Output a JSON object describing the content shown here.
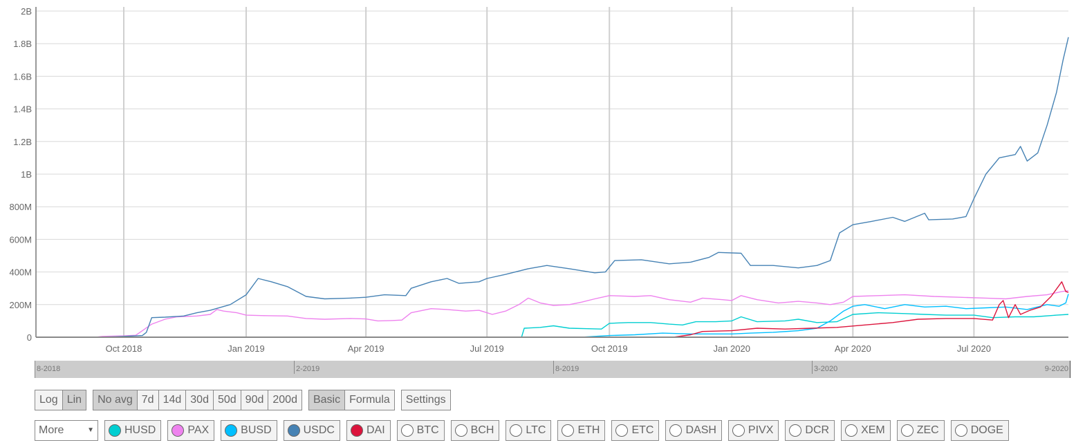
{
  "chart_data": {
    "type": "line",
    "title": "",
    "xlabel": "",
    "ylabel": "",
    "ylim": [
      0,
      2000000000
    ],
    "xlim": [
      "2018-07-27",
      "2020-09-10"
    ],
    "grid": true,
    "y_ticks": [
      {
        "value": 0,
        "label": "0"
      },
      {
        "value": 200000000,
        "label": "200M"
      },
      {
        "value": 400000000,
        "label": "400M"
      },
      {
        "value": 600000000,
        "label": "600M"
      },
      {
        "value": 800000000,
        "label": "800M"
      },
      {
        "value": 1000000000,
        "label": "1B"
      },
      {
        "value": 1200000000,
        "label": "1.2B"
      },
      {
        "value": 1400000000,
        "label": "1.4B"
      },
      {
        "value": 1600000000,
        "label": "1.6B"
      },
      {
        "value": 1800000000,
        "label": "1.8B"
      },
      {
        "value": 2000000000,
        "label": "2B"
      }
    ],
    "x_ticks": [
      {
        "date": "2018-10-01",
        "label": "Oct 2018"
      },
      {
        "date": "2019-01-01",
        "label": "Jan 2019"
      },
      {
        "date": "2019-04-01",
        "label": "Apr 2019"
      },
      {
        "date": "2019-07-01",
        "label": "Jul 2019"
      },
      {
        "date": "2019-10-01",
        "label": "Oct 2019"
      },
      {
        "date": "2020-01-01",
        "label": "Jan 2020"
      },
      {
        "date": "2020-04-01",
        "label": "Apr 2020"
      },
      {
        "date": "2020-07-01",
        "label": "Jul 2020"
      }
    ],
    "value_unit": "millions",
    "series": [
      {
        "name": "PAX",
        "color": "#EE82EE",
        "points": [
          [
            "2018-07-27",
            0
          ],
          [
            "2018-09-10",
            0
          ],
          [
            "2018-09-15",
            5
          ],
          [
            "2018-10-01",
            8
          ],
          [
            "2018-10-10",
            12
          ],
          [
            "2018-10-15",
            40
          ],
          [
            "2018-10-22",
            80
          ],
          [
            "2018-11-01",
            110
          ],
          [
            "2018-11-10",
            125
          ],
          [
            "2018-11-25",
            130
          ],
          [
            "2018-12-05",
            140
          ],
          [
            "2018-12-10",
            170
          ],
          [
            "2018-12-15",
            160
          ],
          [
            "2018-12-25",
            150
          ],
          [
            "2019-01-01",
            135
          ],
          [
            "2019-01-15",
            132
          ],
          [
            "2019-02-01",
            130
          ],
          [
            "2019-02-15",
            115
          ],
          [
            "2019-03-01",
            110
          ],
          [
            "2019-03-20",
            115
          ],
          [
            "2019-04-01",
            112
          ],
          [
            "2019-04-10",
            100
          ],
          [
            "2019-04-20",
            102
          ],
          [
            "2019-04-28",
            105
          ],
          [
            "2019-05-05",
            150
          ],
          [
            "2019-05-20",
            175
          ],
          [
            "2019-06-01",
            170
          ],
          [
            "2019-06-15",
            160
          ],
          [
            "2019-06-25",
            165
          ],
          [
            "2019-07-01",
            150
          ],
          [
            "2019-07-05",
            140
          ],
          [
            "2019-07-15",
            160
          ],
          [
            "2019-07-25",
            200
          ],
          [
            "2019-08-01",
            240
          ],
          [
            "2019-08-10",
            210
          ],
          [
            "2019-08-20",
            195
          ],
          [
            "2019-09-01",
            200
          ],
          [
            "2019-09-10",
            215
          ],
          [
            "2019-09-20",
            235
          ],
          [
            "2019-10-01",
            255
          ],
          [
            "2019-10-20",
            250
          ],
          [
            "2019-11-01",
            255
          ],
          [
            "2019-11-15",
            230
          ],
          [
            "2019-12-01",
            215
          ],
          [
            "2019-12-10",
            240
          ],
          [
            "2019-12-25",
            230
          ],
          [
            "2020-01-01",
            225
          ],
          [
            "2020-01-08",
            255
          ],
          [
            "2020-01-20",
            230
          ],
          [
            "2020-02-05",
            210
          ],
          [
            "2020-02-20",
            220
          ],
          [
            "2020-03-05",
            210
          ],
          [
            "2020-03-15",
            200
          ],
          [
            "2020-03-25",
            215
          ],
          [
            "2020-04-01",
            250
          ],
          [
            "2020-04-20",
            255
          ],
          [
            "2020-05-10",
            260
          ],
          [
            "2020-06-01",
            250
          ],
          [
            "2020-06-20",
            245
          ],
          [
            "2020-07-10",
            240
          ],
          [
            "2020-07-25",
            235
          ],
          [
            "2020-08-10",
            250
          ],
          [
            "2020-08-25",
            260
          ],
          [
            "2020-09-05",
            280
          ],
          [
            "2020-09-10",
            285
          ]
        ]
      },
      {
        "name": "HUSD",
        "color": "#00CED1",
        "points": [
          [
            "2019-07-27",
            0
          ],
          [
            "2019-07-29",
            55
          ],
          [
            "2019-08-10",
            60
          ],
          [
            "2019-08-20",
            70
          ],
          [
            "2019-09-01",
            55
          ],
          [
            "2019-09-15",
            52
          ],
          [
            "2019-09-25",
            50
          ],
          [
            "2019-10-01",
            85
          ],
          [
            "2019-10-15",
            90
          ],
          [
            "2019-11-01",
            90
          ],
          [
            "2019-11-15",
            80
          ],
          [
            "2019-11-25",
            75
          ],
          [
            "2019-12-05",
            95
          ],
          [
            "2019-12-20",
            95
          ],
          [
            "2020-01-01",
            100
          ],
          [
            "2020-01-08",
            125
          ],
          [
            "2020-01-20",
            95
          ],
          [
            "2020-02-10",
            100
          ],
          [
            "2020-02-20",
            110
          ],
          [
            "2020-03-05",
            90
          ],
          [
            "2020-03-20",
            95
          ],
          [
            "2020-04-01",
            140
          ],
          [
            "2020-04-20",
            150
          ],
          [
            "2020-05-10",
            145
          ],
          [
            "2020-05-25",
            140
          ],
          [
            "2020-06-10",
            135
          ],
          [
            "2020-07-01",
            135
          ],
          [
            "2020-07-15",
            120
          ],
          [
            "2020-08-01",
            125
          ],
          [
            "2020-08-15",
            125
          ],
          [
            "2020-09-01",
            135
          ],
          [
            "2020-09-10",
            140
          ]
        ]
      },
      {
        "name": "BUSD",
        "color": "#00BFFF",
        "points": [
          [
            "2019-09-10",
            0
          ],
          [
            "2019-09-20",
            5
          ],
          [
            "2019-10-01",
            10
          ],
          [
            "2019-10-20",
            15
          ],
          [
            "2019-11-10",
            25
          ],
          [
            "2019-12-01",
            20
          ],
          [
            "2019-12-20",
            20
          ],
          [
            "2020-01-01",
            20
          ],
          [
            "2020-01-15",
            25
          ],
          [
            "2020-02-01",
            30
          ],
          [
            "2020-02-20",
            40
          ],
          [
            "2020-03-05",
            55
          ],
          [
            "2020-03-15",
            100
          ],
          [
            "2020-03-25",
            160
          ],
          [
            "2020-04-01",
            190
          ],
          [
            "2020-04-10",
            200
          ],
          [
            "2020-04-25",
            175
          ],
          [
            "2020-05-10",
            200
          ],
          [
            "2020-05-25",
            185
          ],
          [
            "2020-06-10",
            190
          ],
          [
            "2020-06-25",
            175
          ],
          [
            "2020-07-10",
            180
          ],
          [
            "2020-07-25",
            185
          ],
          [
            "2020-08-10",
            170
          ],
          [
            "2020-08-25",
            200
          ],
          [
            "2020-09-03",
            190
          ],
          [
            "2020-09-08",
            210
          ],
          [
            "2020-09-10",
            265
          ]
        ]
      },
      {
        "name": "USDC",
        "color": "#4682B4",
        "points": [
          [
            "2018-07-27",
            0
          ],
          [
            "2018-09-10",
            0
          ],
          [
            "2018-09-25",
            3
          ],
          [
            "2018-10-01",
            5
          ],
          [
            "2018-10-15",
            10
          ],
          [
            "2018-10-18",
            30
          ],
          [
            "2018-10-22",
            120
          ],
          [
            "2018-11-01",
            123
          ],
          [
            "2018-11-15",
            130
          ],
          [
            "2018-11-25",
            150
          ],
          [
            "2018-12-05",
            165
          ],
          [
            "2018-12-20",
            200
          ],
          [
            "2019-01-01",
            260
          ],
          [
            "2019-01-10",
            360
          ],
          [
            "2019-01-20",
            340
          ],
          [
            "2019-02-01",
            310
          ],
          [
            "2019-02-15",
            250
          ],
          [
            "2019-03-01",
            235
          ],
          [
            "2019-03-20",
            240
          ],
          [
            "2019-04-01",
            245
          ],
          [
            "2019-04-15",
            260
          ],
          [
            "2019-05-01",
            255
          ],
          [
            "2019-05-05",
            300
          ],
          [
            "2019-05-20",
            340
          ],
          [
            "2019-06-01",
            360
          ],
          [
            "2019-06-10",
            330
          ],
          [
            "2019-06-25",
            340
          ],
          [
            "2019-07-01",
            360
          ],
          [
            "2019-07-15",
            385
          ],
          [
            "2019-08-01",
            420
          ],
          [
            "2019-08-15",
            440
          ],
          [
            "2019-09-01",
            420
          ],
          [
            "2019-09-20",
            395
          ],
          [
            "2019-09-28",
            400
          ],
          [
            "2019-10-05",
            470
          ],
          [
            "2019-10-25",
            475
          ],
          [
            "2019-11-15",
            450
          ],
          [
            "2019-12-01",
            460
          ],
          [
            "2019-12-15",
            490
          ],
          [
            "2019-12-22",
            520
          ],
          [
            "2020-01-08",
            515
          ],
          [
            "2020-01-15",
            440
          ],
          [
            "2020-02-01",
            440
          ],
          [
            "2020-02-20",
            425
          ],
          [
            "2020-03-05",
            440
          ],
          [
            "2020-03-15",
            470
          ],
          [
            "2020-03-22",
            640
          ],
          [
            "2020-04-01",
            690
          ],
          [
            "2020-04-15",
            710
          ],
          [
            "2020-05-01",
            735
          ],
          [
            "2020-05-10",
            710
          ],
          [
            "2020-05-25",
            760
          ],
          [
            "2020-05-28",
            720
          ],
          [
            "2020-06-15",
            725
          ],
          [
            "2020-06-25",
            740
          ],
          [
            "2020-07-01",
            850
          ],
          [
            "2020-07-10",
            1000
          ],
          [
            "2020-07-20",
            1100
          ],
          [
            "2020-08-01",
            1120
          ],
          [
            "2020-08-05",
            1170
          ],
          [
            "2020-08-10",
            1080
          ],
          [
            "2020-08-18",
            1130
          ],
          [
            "2020-08-25",
            1300
          ],
          [
            "2020-09-01",
            1500
          ],
          [
            "2020-09-06",
            1700
          ],
          [
            "2020-09-10",
            1840
          ]
        ]
      },
      {
        "name": "DAI",
        "color": "#DC143C",
        "points": [
          [
            "2019-11-18",
            0
          ],
          [
            "2019-12-01",
            15
          ],
          [
            "2019-12-10",
            35
          ],
          [
            "2020-01-01",
            40
          ],
          [
            "2020-01-20",
            55
          ],
          [
            "2020-02-10",
            50
          ],
          [
            "2020-03-01",
            55
          ],
          [
            "2020-03-20",
            60
          ],
          [
            "2020-04-10",
            75
          ],
          [
            "2020-05-01",
            90
          ],
          [
            "2020-05-20",
            110
          ],
          [
            "2020-06-10",
            115
          ],
          [
            "2020-07-01",
            115
          ],
          [
            "2020-07-15",
            105
          ],
          [
            "2020-07-20",
            200
          ],
          [
            "2020-07-23",
            225
          ],
          [
            "2020-07-27",
            120
          ],
          [
            "2020-08-01",
            200
          ],
          [
            "2020-08-05",
            140
          ],
          [
            "2020-08-12",
            165
          ],
          [
            "2020-08-20",
            185
          ],
          [
            "2020-08-28",
            250
          ],
          [
            "2020-09-05",
            340
          ],
          [
            "2020-09-08",
            280
          ],
          [
            "2020-09-10",
            275
          ]
        ]
      }
    ]
  },
  "navigator": {
    "labels": [
      "8-2018",
      "2-2019",
      "8-2019",
      "3-2020",
      "9-2020"
    ]
  },
  "controls": {
    "scale": [
      {
        "label": "Log",
        "active": false
      },
      {
        "label": "Lin",
        "active": true
      }
    ],
    "averages": [
      {
        "label": "No avg",
        "active": true
      },
      {
        "label": "7d"
      },
      {
        "label": "14d"
      },
      {
        "label": "30d"
      },
      {
        "label": "50d"
      },
      {
        "label": "90d"
      },
      {
        "label": "200d"
      }
    ],
    "mode": [
      {
        "label": "Basic",
        "active": true
      },
      {
        "label": "Formula"
      }
    ],
    "settings_label": "Settings"
  },
  "coins": {
    "more_select": {
      "value": "More",
      "arrow": "▼"
    },
    "items": [
      {
        "label": "HUSD",
        "color": "#00CED1",
        "selected": true
      },
      {
        "label": "PAX",
        "color": "#EE82EE",
        "selected": true
      },
      {
        "label": "BUSD",
        "color": "#00BFFF",
        "selected": true
      },
      {
        "label": "USDC",
        "color": "#4682B4",
        "selected": true
      },
      {
        "label": "DAI",
        "color": "#DC143C",
        "selected": true
      },
      {
        "label": "BTC",
        "color": "#ffffff",
        "selected": false
      },
      {
        "label": "BCH",
        "color": "#ffffff",
        "selected": false
      },
      {
        "label": "LTC",
        "color": "#ffffff",
        "selected": false
      },
      {
        "label": "ETH",
        "color": "#ffffff",
        "selected": false
      },
      {
        "label": "ETC",
        "color": "#ffffff",
        "selected": false
      },
      {
        "label": "DASH",
        "color": "#ffffff",
        "selected": false
      },
      {
        "label": "PIVX",
        "color": "#ffffff",
        "selected": false
      },
      {
        "label": "DCR",
        "color": "#ffffff",
        "selected": false
      },
      {
        "label": "XEM",
        "color": "#ffffff",
        "selected": false
      },
      {
        "label": "ZEC",
        "color": "#ffffff",
        "selected": false
      },
      {
        "label": "DOGE",
        "color": "#ffffff",
        "selected": false
      }
    ]
  }
}
